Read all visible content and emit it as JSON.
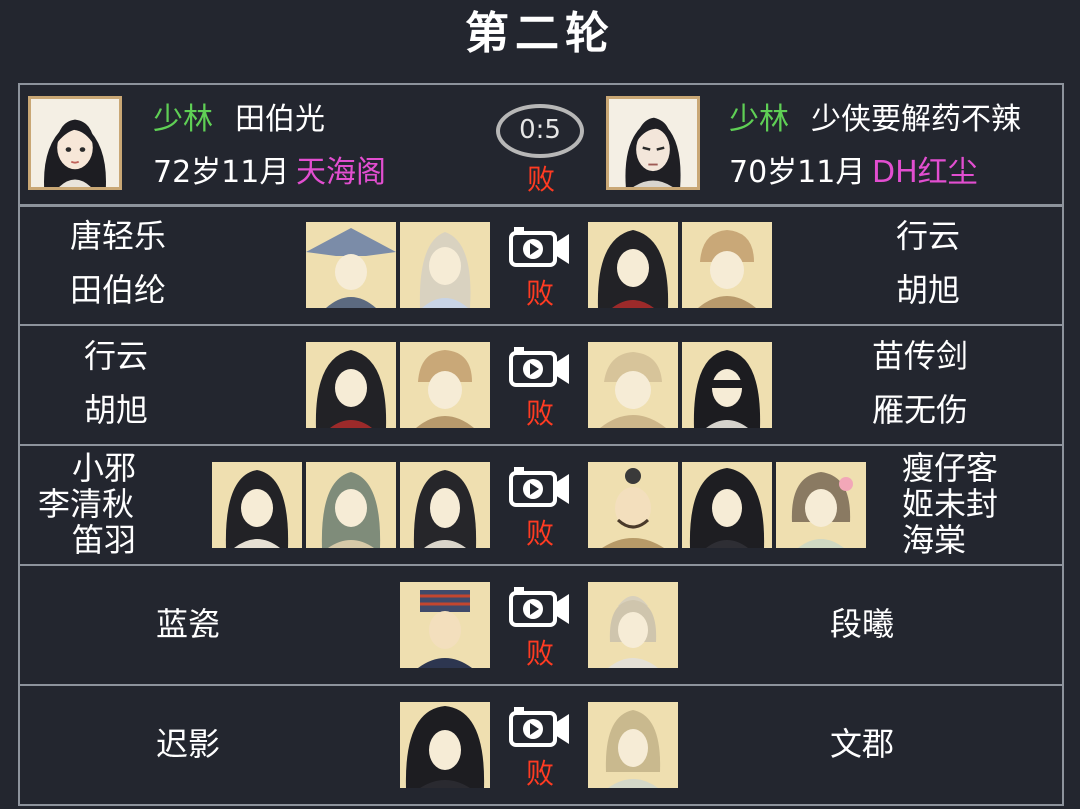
{
  "title": "第二轮",
  "header": {
    "left": {
      "school": "少林",
      "player": "田伯光",
      "age": "72岁11月",
      "guild": "天海阁"
    },
    "right": {
      "school": "少林",
      "player": "少侠要解药不辣",
      "age": "70岁11月",
      "guild": "DH红尘"
    },
    "score": "0:5",
    "result": "败"
  },
  "icons": {
    "replay": "video-camera-icon"
  },
  "colors": {
    "background": "#23262f",
    "school": "#5fcf55",
    "guild": "#e24ed0",
    "lose": "#ff3b22",
    "border": "#8d939c",
    "card": "#efdfb0"
  },
  "matches": [
    {
      "left": [
        "唐轻乐",
        "田伯纶"
      ],
      "right": [
        "行云",
        "胡旭"
      ],
      "result": "败"
    },
    {
      "left": [
        "行云",
        "胡旭"
      ],
      "right": [
        "苗传剑",
        "雁无伤"
      ],
      "result": "败"
    },
    {
      "left": [
        "小邪",
        "李清秋",
        "笛羽"
      ],
      "right": [
        "瘦仔客",
        "姬未封",
        "海棠"
      ],
      "result": "败"
    },
    {
      "left": [
        "蓝瓷"
      ],
      "right": [
        "段曦"
      ],
      "result": "败"
    },
    {
      "left": [
        "迟影"
      ],
      "right": [
        "文郡"
      ],
      "result": "败"
    }
  ]
}
